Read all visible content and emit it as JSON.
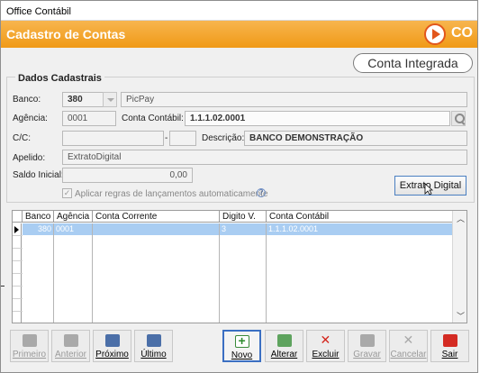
{
  "window": {
    "title": "Office Contábil"
  },
  "header": {
    "title": "Cadastro de Contas",
    "brand": "CO",
    "accent": "#f09a17"
  },
  "badge": {
    "label": "Conta Integrada"
  },
  "section": {
    "title": "Dados Cadastrais"
  },
  "form": {
    "banco_label": "Banco:",
    "banco_code": "380",
    "banco_name": "PicPay",
    "agencia_label": "Agência:",
    "agencia_value": "0001",
    "conta_contabil_label": "Conta Contábil:",
    "conta_contabil_value": "1.1.1.02.0001",
    "cc_label": "C/C:",
    "cc_value": "",
    "cc_digit": "",
    "cc_sep": "-",
    "descricao_label": "Descrição:",
    "descricao_value": "BANCO DEMONSTRAÇÃO",
    "apelido_label": "Apelido:",
    "apelido_value": "ExtratoDigital",
    "saldo_label": "Saldo Inicial:",
    "saldo_value": "0,00",
    "regras_label": "Aplicar regras de lançamentos automaticamente",
    "regras_checked": true,
    "extrato_button": "Extrato Digital"
  },
  "grid": {
    "columns": [
      "Banco",
      "Agência",
      "Conta Corrente",
      "Digito V.",
      "Conta Contábil"
    ],
    "rows": [
      {
        "banco": "380",
        "agencia": "0001",
        "conta_corrente": "",
        "digito": "3",
        "conta_contabil": "1.1.1.02.0001"
      }
    ]
  },
  "toolbar": {
    "primeiro": "Primeiro",
    "anterior": "Anterior",
    "proximo": "Próximo",
    "ultimo": "Último",
    "novo": "Novo",
    "alterar": "Alterar",
    "excluir": "Excluir",
    "gravar": "Gravar",
    "cancelar": "Cancelar",
    "sair": "Sair"
  }
}
